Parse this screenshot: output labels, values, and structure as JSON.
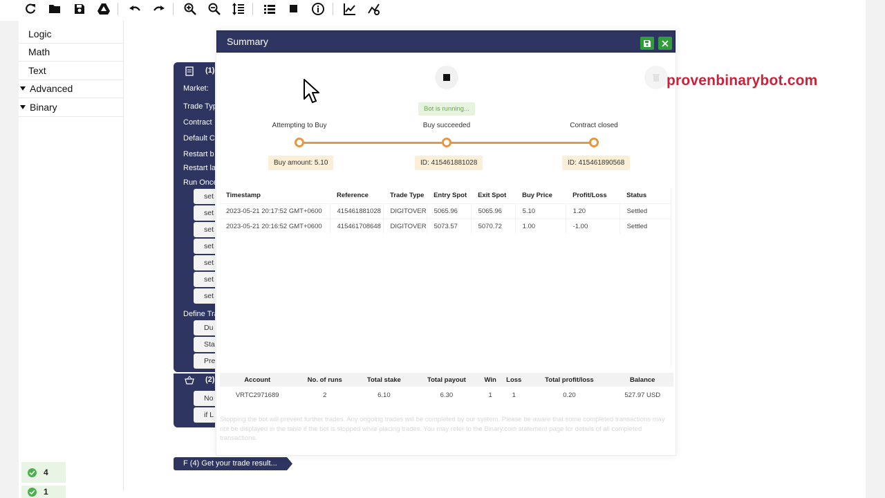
{
  "toolbar": {
    "buttons": [
      {
        "name": "reload-icon"
      },
      {
        "name": "folder-icon"
      },
      {
        "name": "save-icon"
      },
      {
        "name": "google-drive-icon"
      },
      {
        "name": "undo-icon"
      },
      {
        "name": "redo-icon"
      },
      {
        "name": "zoom-in-icon"
      },
      {
        "name": "zoom-out-icon"
      },
      {
        "name": "sort-icon"
      },
      {
        "name": "list-icon"
      },
      {
        "name": "stop-icon"
      },
      {
        "name": "info-icon"
      },
      {
        "name": "chart-icon"
      },
      {
        "name": "indicator-icon"
      }
    ]
  },
  "sidebar": {
    "items": [
      {
        "label": "Logic",
        "expandable": false
      },
      {
        "label": "Math",
        "expandable": false
      },
      {
        "label": "Text",
        "expandable": false
      },
      {
        "label": "Advanced",
        "expandable": true
      },
      {
        "label": "Binary",
        "expandable": true
      }
    ]
  },
  "blocks": {
    "main_number": "(1)",
    "market": "Market:",
    "trade_type": "Trade Typ",
    "contract": "Contract",
    "default": "Default C",
    "restart_b": "Restart b",
    "restart_l": "Restart la",
    "run_once": "Run Once",
    "set_items": [
      "set",
      "set",
      "set",
      "set",
      "set",
      "set",
      "set"
    ],
    "define": "Define Tra",
    "define_items": [
      "Du",
      "Sta",
      "Pre"
    ],
    "second_number": "(2)",
    "second_items": [
      "No",
      "if L"
    ],
    "get_result": "F (4) Get your trade result..."
  },
  "counters": [
    {
      "value": "4"
    },
    {
      "value": "1"
    }
  ],
  "dialog": {
    "title": "Summary",
    "status": "Bot is running...",
    "steps": [
      {
        "label": "Attempting to Buy",
        "tag": "Buy amount: 5.10"
      },
      {
        "label": "Buy succeeded",
        "tag": "ID: 415461881028"
      },
      {
        "label": "Contract closed",
        "tag": "ID: 415461890568"
      }
    ],
    "trades": {
      "headers": [
        "Timestamp",
        "Reference",
        "Trade Type",
        "Entry Spot",
        "Exit Spot",
        "Buy Price",
        "Profit/Loss",
        "Status"
      ],
      "rows": [
        {
          "timestamp": "2023-05-21 20:17:52 GMT+0600",
          "reference": "415461881028",
          "trade_type": "DIGITOVER",
          "entry": "5065.96",
          "exit": "5065.96",
          "buy_price": "5.10",
          "profit": "1.20",
          "status": "Settled"
        },
        {
          "timestamp": "2023-05-21 20:16:52 GMT+0600",
          "reference": "415461708648",
          "trade_type": "DIGITOVER",
          "entry": "5073.57",
          "exit": "5070.72",
          "buy_price": "1.00",
          "profit": "-1.00",
          "status": "Settled"
        }
      ]
    },
    "stats": {
      "headers": [
        "Account",
        "No. of runs",
        "Total stake",
        "Total payout",
        "Win",
        "Loss",
        "Total profit/loss",
        "Balance"
      ],
      "values": {
        "account": "VRTC2971689",
        "runs": "2",
        "stake": "6.10",
        "payout": "6.30",
        "win": "1",
        "loss": "1",
        "profit": "0.20",
        "balance": "527.97 USD"
      }
    },
    "disclaimer": "Stopping the bot will prevent further trades. Any ongoing trades will be completed by our system. Please be aware that some completed transactions may not be displayed in the table if the bot is stopped while placing trades. You may refer to the Binary.com statement page for details of all completed transactions."
  },
  "watermark": "provenbinarybot.com",
  "colors": {
    "header": "#2d3560",
    "accent_green": "#2f9d38",
    "progress": "#e8963f",
    "profit": "#39a12e",
    "loss": "#d3322c",
    "watermark": "#c8233a"
  }
}
